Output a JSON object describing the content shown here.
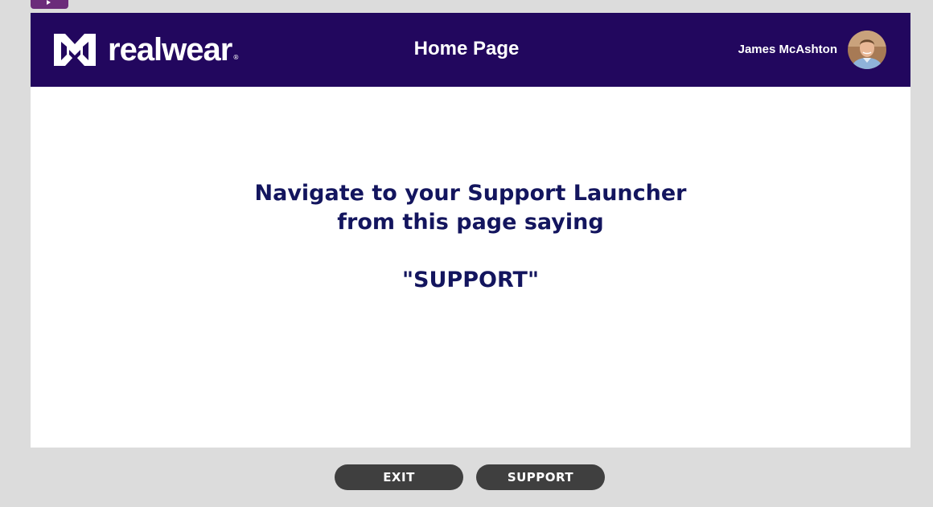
{
  "header": {
    "brand": "realwear",
    "brand_mark": "®",
    "title": "Home Page",
    "user_name": "James McAshton"
  },
  "main": {
    "instruction_line1": "Navigate to your Support Launcher",
    "instruction_line2": "from this page saying",
    "keyword": "\"SUPPORT\""
  },
  "footer": {
    "exit_label": "EXIT",
    "support_label": "SUPPORT"
  },
  "colors": {
    "header_bg": "#22075e",
    "instruction_text": "#13155e",
    "button_bg": "#3f3f3f",
    "footer_bg": "#dcdcdc",
    "corner_tab": "#6b2c7a"
  },
  "icons": {
    "corner": "play-icon",
    "logo": "realwear-logo-icon",
    "avatar": "user-avatar-photo"
  }
}
